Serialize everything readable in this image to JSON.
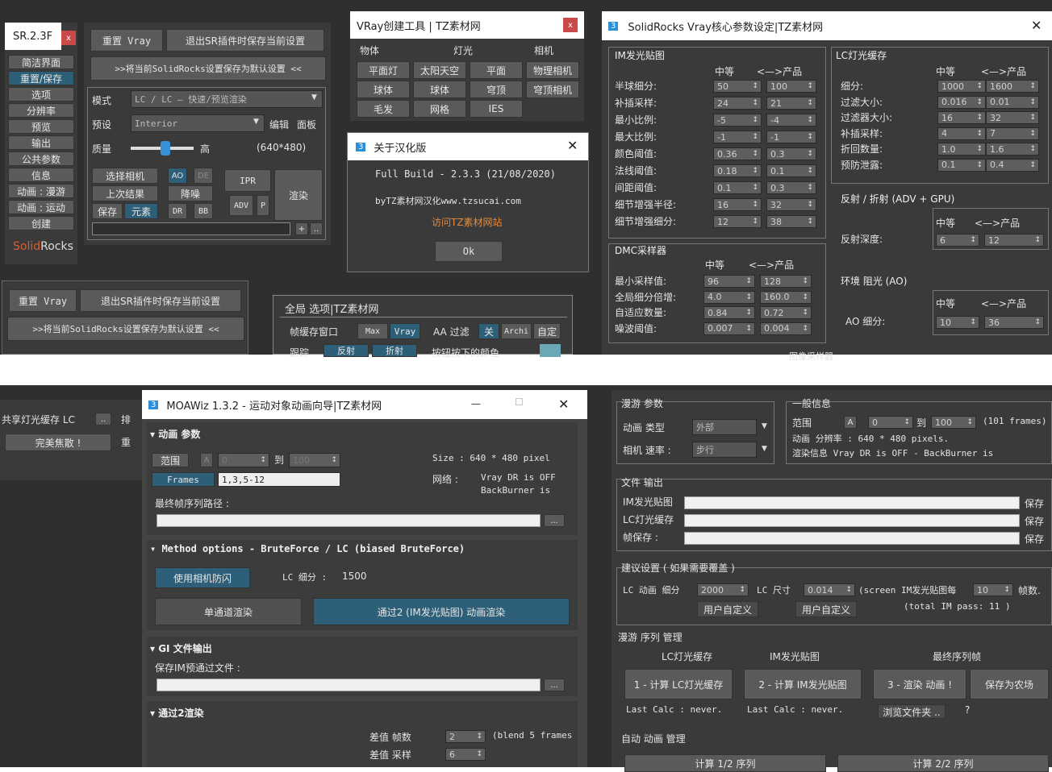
{
  "sr_side": {
    "title": "SR.2.3F",
    "close": "x",
    "items": [
      "简洁界面",
      "重置/保存",
      "选项",
      "分辨率",
      "预览",
      "输出",
      "公共参数",
      "信息",
      "动画 : 漫游",
      "动画 : 运动",
      "创建"
    ],
    "logo_a": "Solid",
    "logo_b": "Rocks"
  },
  "sr_main": {
    "reset_btn": "重置 Vray",
    "save_exit_btn": "退出SR插件时保存当前设置",
    "save_default_btn": ">>将当前SolidRocks设置保存为默认设置 <<",
    "mode_label": "模式",
    "mode_value": "LC / LC — 快速/预览渲染",
    "preset_label": "预设",
    "preset_value": "Interior",
    "edit_btn": "编辑",
    "panel_btn": "面板",
    "quality_label": "质量",
    "quality_high": "高",
    "quality_res": "(640*480)",
    "quality_fraction": 0.55,
    "select_cam": "选择相机",
    "ao": "AO",
    "de": "DE",
    "ipr": "IPR",
    "render": "渲染",
    "last_result": "上次结果",
    "denoise": "降噪",
    "adv": "ADV",
    "p": "P",
    "save": "保存",
    "elements": "元素",
    "dr": "DR",
    "bb": "BB",
    "plus": "+",
    "dots": ".."
  },
  "sr_bottom": {
    "reset_btn": "重置 Vray",
    "save_exit_btn": "退出SR插件时保存当前设置",
    "save_default_btn": ">>将当前SolidRocks设置保存为默认设置 <<"
  },
  "global_opts": {
    "title": "全局 选项|TZ素材网",
    "frame_buffer": "帧缓存窗口",
    "max": "Max",
    "vray": "Vray",
    "aa_filter": "AA 过滤",
    "off": "关",
    "archi": "Archi",
    "custom": "自定",
    "row2_a": "跟踪",
    "row2_b": "反射",
    "row2_c": "折射",
    "row2_d": "按钮按下的颜色"
  },
  "vray_tools": {
    "title": "VRay创建工具 | TZ素材网",
    "close": "x",
    "col_object": "物体",
    "col_light": "灯光",
    "col_camera": "相机",
    "buttons": [
      "平面灯",
      "太阳天空",
      "平面",
      "物理相机",
      "球体",
      "球体",
      "穹顶",
      "穹顶相机",
      "毛发",
      "网格",
      "IES"
    ]
  },
  "about": {
    "title": "关于汉化版",
    "close": "✕",
    "build": "Full Build - 2.3.3 (21/08/2020)",
    "by": "byTZ素材网汉化www.tzsucai.com",
    "link": "访问TZ素材网站",
    "ok": "Ok"
  },
  "core": {
    "title": "SolidRocks Vray核心参数设定|TZ素材网",
    "close": "✕",
    "im_title": "IM发光贴图",
    "mid": "中等",
    "prod": "<—>产品",
    "im_rows": [
      {
        "label": "半球细分:",
        "a": "50",
        "b": "100"
      },
      {
        "label": "补插采样:",
        "a": "24",
        "b": "21"
      },
      {
        "label": "最小比例:",
        "a": "-5",
        "b": "-4"
      },
      {
        "label": "最大比例:",
        "a": "-1",
        "b": "-1"
      },
      {
        "label": "颜色阈值:",
        "a": "0.36",
        "b": "0.3"
      },
      {
        "label": "法线阈值:",
        "a": "0.18",
        "b": "0.1"
      },
      {
        "label": "间距阈值:",
        "a": "0.1",
        "b": "0.3"
      },
      {
        "label": "细节增强半径:",
        "a": "16",
        "b": "32"
      },
      {
        "label": "细节增强细分:",
        "a": "12",
        "b": "38"
      }
    ],
    "lc_title": "LC灯光缓存",
    "lc_rows": [
      {
        "label": "细分:",
        "a": "1000",
        "b": "1600"
      },
      {
        "label": "过滤大小:",
        "a": "0.016",
        "b": "0.01"
      },
      {
        "label": "过滤器大小:",
        "a": "16",
        "b": "32"
      },
      {
        "label": "补插采样:",
        "a": "4",
        "b": "7"
      },
      {
        "label": "折回数量:",
        "a": "1.0",
        "b": "1.6"
      },
      {
        "label": "预防泄露:",
        "a": "0.1",
        "b": "0.4"
      }
    ],
    "dmc_title": "DMC采样器",
    "dmc_rows": [
      {
        "label": "最小采样值:",
        "a": "96",
        "b": "128"
      },
      {
        "label": "全局细分倍增:",
        "a": "4.0",
        "b": "160.0"
      },
      {
        "label": "自适应数量:",
        "a": "0.84",
        "b": "0.72"
      },
      {
        "label": "噪波阈值:",
        "a": "0.007",
        "b": "0.004"
      }
    ],
    "refl_title": "反射 / 折射 (ADV + GPU)",
    "refl_label": "反射深度:",
    "refl_a": "6",
    "refl_b": "12",
    "ao_title": "环境 阻光 (AO)",
    "ao_label": "AO 细分:",
    "ao_a": "10",
    "ao_b": "36",
    "cut_label": "图像采样器"
  },
  "left_strip": {
    "item1": "共享灯光缓存 LC",
    "item1b": "..",
    "item2": "完美焦散 !",
    "side1": "排",
    "side2": "重"
  },
  "moawiz": {
    "title": "MOAWiz 1.3.2 - 运动对象动画向导|TZ素材网",
    "min": "—",
    "max": "☐",
    "close": "✕",
    "anim_section": "动画 参数",
    "range": "范围",
    "a": "A",
    "from": "0",
    "to_label": "到",
    "to": "100",
    "size": "Size : 640 * 480 pixel",
    "frames": "Frames",
    "frames_value": "1,3,5-12",
    "network": "网络 :",
    "net_info": "Vray DR is OFF",
    "net_info2": "BackBurner is",
    "final_path": "最终帧序列路径 :",
    "method_section": "Method options - BruteForce / LC (biased BruteForce)",
    "use_cam": "使用相机防闪",
    "lc_sub_label": "LC 细分 :",
    "lc_sub": "1500",
    "single_pass": "单通道渲染",
    "two_pass": "通过2 (IM发光贴图) 动画渲染",
    "gi_section": "GI 文件输出",
    "save_im": "保存IM预通过文件 :",
    "pass2_section": "通过2渲染",
    "interp_frames": "差值 帧数",
    "interp_frames_v": "2",
    "blend": "(blend 5 frames",
    "interp_samples": "差值 采样",
    "interp_samples_v": "6",
    "dots": "..."
  },
  "walk": {
    "walk_params": "漫游 参数",
    "anim_type": "动画 类型",
    "anim_type_v": "外部",
    "cam_speed": "相机 速率 :",
    "cam_speed_v": "步行",
    "general": "一般信息",
    "range": "范围",
    "a": "A",
    "from": "0",
    "to_label": "到",
    "to": "100",
    "frames_info": "(101 frames)",
    "res": "动画 分辨率 : 640 * 480 pixels.",
    "render_info": "渲染信息 Vray DR is OFF - BackBurner is",
    "file_out": "文件 输出",
    "im_map": "IM发光贴图",
    "lc_cache": "LC灯光缓存",
    "frame_save": "帧保存 :",
    "save": "保存",
    "suggest": "建议设置 ( 如果需要覆盖 )",
    "lc_anim": "LC 动画 细分",
    "lc_anim_v": "2000",
    "lc_size": "LC 尺寸",
    "lc_size_v": "0.014",
    "screen_im": "(screen IM发光贴图每",
    "screen_im_v": "10",
    "frames_word": "帧数.",
    "user_def1": "用户自定义",
    "user_def2": "用户自定义",
    "total_im": "(total IM pass: 11 )",
    "seq_mgmt": "漫游 序列 管理",
    "col_lc": "LC灯光缓存",
    "col_im": "IM发光贴图",
    "col_final": "最终序列帧",
    "calc_lc": "1 - 计算 LC灯光缓存",
    "calc_im": "2 - 计算 IM发光贴图",
    "render_anim": "3 - 渲染 动画 !",
    "save_farm": "保存为农场",
    "last_calc1": "Last Calc : never.",
    "last_calc2": "Last Calc : never.",
    "browse": "浏览文件夹 ..",
    "question": "?",
    "auto_mgmt": "自动 动画 管理",
    "calc_1_2": "计算 1/2 序列",
    "calc_2_2": "计算 2/2 序列"
  }
}
